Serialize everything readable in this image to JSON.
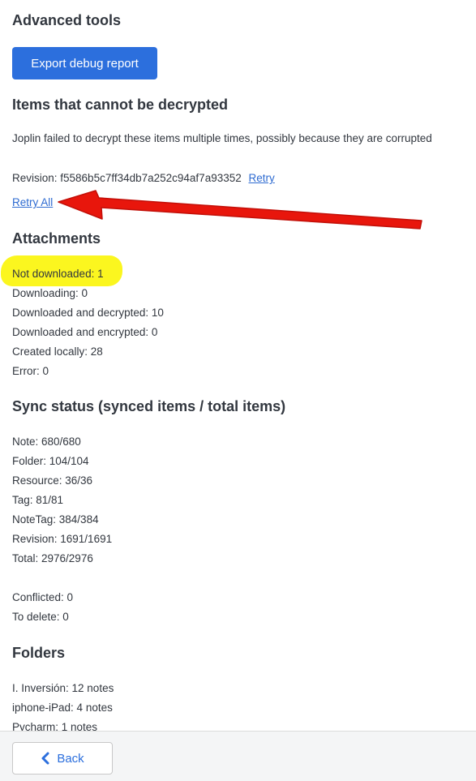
{
  "advanced_tools": {
    "heading": "Advanced tools",
    "export_button": "Export debug report"
  },
  "decrypt": {
    "heading": "Items that cannot be decrypted",
    "description": "Joplin failed to decrypt these items multiple times, possibly because they are corrupted",
    "revision_text": "Revision: f5586b5c7ff34db7a252c94af7a93352",
    "retry_link": "Retry",
    "retry_all_link": "Retry All"
  },
  "attachments": {
    "heading": "Attachments",
    "lines": [
      "Not downloaded: 1",
      "Downloading: 0",
      "Downloaded and decrypted: 10",
      "Downloaded and encrypted: 0",
      "Created locally: 28",
      "Error: 0"
    ]
  },
  "sync": {
    "heading": "Sync status (synced items / total items)",
    "lines": [
      "Note: 680/680",
      "Folder: 104/104",
      "Resource: 36/36",
      "Tag: 81/81",
      "NoteTag: 384/384",
      "Revision: 1691/1691",
      "Total: 2976/2976"
    ],
    "extra_lines": [
      "Conflicted: 0",
      "To delete: 0"
    ]
  },
  "folders": {
    "heading": "Folders",
    "lines": [
      "I. Inversión: 12 notes",
      "iphone-iPad: 4 notes",
      "Pycharm: 1 notes"
    ]
  },
  "footer": {
    "back_label": "Back"
  },
  "annotation": {
    "highlight_color": "#fbf61f",
    "arrow_color": "#e8160c"
  }
}
